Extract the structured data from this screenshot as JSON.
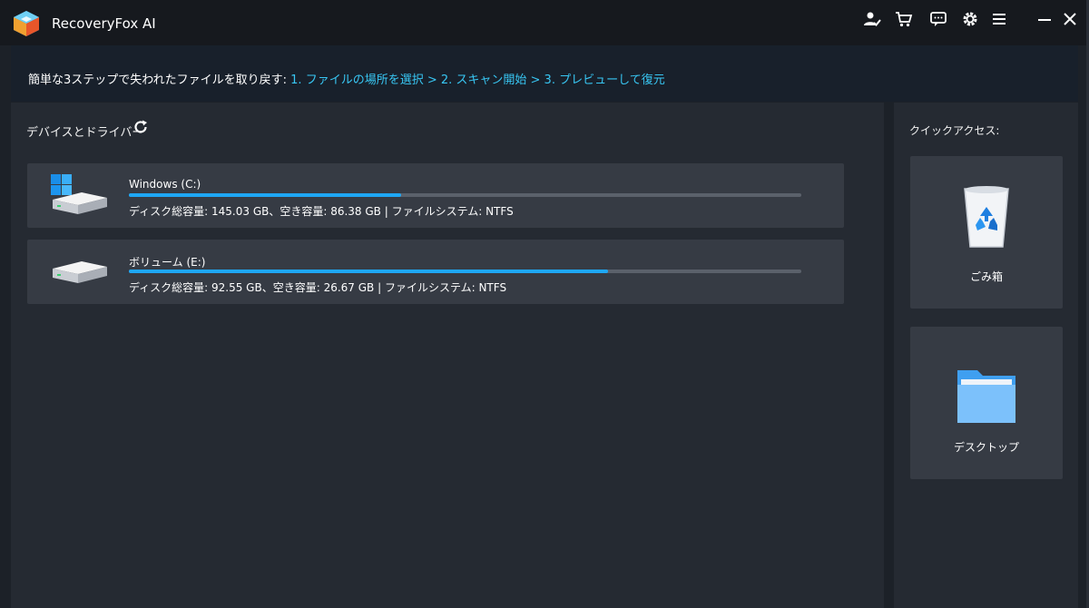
{
  "app": {
    "title": "RecoveryFox AI"
  },
  "titlebar_icons": [
    "account-check-icon",
    "cart-icon",
    "feedback-icon",
    "gear-icon",
    "menu-icon",
    "minimize-icon",
    "close-icon"
  ],
  "steps": {
    "prefix": "簡単な3ステップで失われたファイルを取り戻す:",
    "links": "1. ファイルの場所を選択 > 2. スキャン開始 > 3. プレビューして復元"
  },
  "devices": {
    "title": "デバイスとドライバー",
    "drives": [
      {
        "name": "Windows (C:)",
        "used_fraction": 0.405,
        "info": "ディスク総容量: 145.03 GB、空き容量: 86.38 GB | ファイルシステム: NTFS"
      },
      {
        "name": "ボリューム (E:)",
        "used_fraction": 0.712,
        "info": "ディスク総容量: 92.55 GB、空き容量: 26.67 GB | ファイルシステム: NTFS"
      }
    ]
  },
  "quick_access": {
    "title": "クイックアクセス:",
    "items": [
      {
        "label": "ごみ箱"
      },
      {
        "label": "デスクトップ"
      }
    ]
  },
  "colors": {
    "accent": "#1ea7f5",
    "link": "#38c7f4",
    "panel": "#252a32",
    "tile": "#363b44"
  }
}
